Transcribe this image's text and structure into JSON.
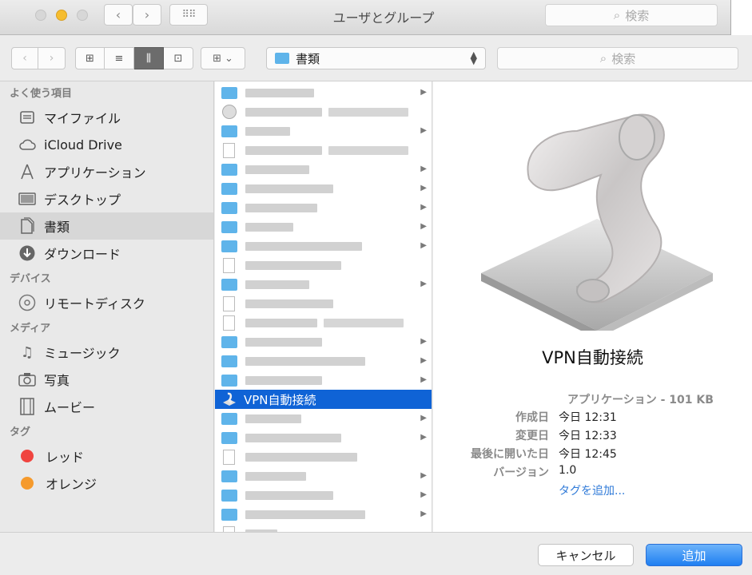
{
  "background_window": {
    "title": "ユーザとグループ",
    "search_placeholder": "検索",
    "back_icon": "‹",
    "forward_icon": "›",
    "grid_icon": "⠿⠿"
  },
  "toolbar": {
    "back_icon": "‹",
    "forward_icon": "›",
    "view_icons": [
      "⊞",
      "≡",
      "⫼",
      "⊡"
    ],
    "arrange_icon": "⊞",
    "arrange_chevron": "⌄",
    "location": "書類",
    "search_placeholder": "検索",
    "search_icon": "⌕"
  },
  "sidebar": {
    "favorites_title": "よく使う項目",
    "favorites": [
      {
        "label": "マイファイル",
        "icon": "all-files-icon"
      },
      {
        "label": "iCloud Drive",
        "icon": "cloud-icon"
      },
      {
        "label": "アプリケーション",
        "icon": "applications-icon"
      },
      {
        "label": "デスクトップ",
        "icon": "desktop-icon"
      },
      {
        "label": "書類",
        "icon": "documents-icon"
      },
      {
        "label": "ダウンロード",
        "icon": "downloads-icon"
      }
    ],
    "devices_title": "デバイス",
    "devices": [
      {
        "label": "リモートディスク",
        "icon": "disc-icon"
      }
    ],
    "media_title": "メディア",
    "media": [
      {
        "label": "ミュージック",
        "icon": "music-icon"
      },
      {
        "label": "写真",
        "icon": "camera-icon"
      },
      {
        "label": "ムービー",
        "icon": "film-icon"
      }
    ],
    "tags_title": "タグ",
    "tags": [
      {
        "label": "レッド",
        "color": "#f0443f"
      },
      {
        "label": "オレンジ",
        "color": "#f59a2c"
      }
    ]
  },
  "file_list": {
    "selected_name": "VPN自動接続"
  },
  "preview": {
    "name": "VPN自動接続",
    "kind": "アプリケーション - 101 KB",
    "rows": [
      {
        "label": "作成日",
        "value": "今日 12:31"
      },
      {
        "label": "変更日",
        "value": "今日 12:33"
      },
      {
        "label": "最後に開いた日",
        "value": "今日 12:45"
      },
      {
        "label": "バージョン",
        "value": "1.0"
      }
    ],
    "add_tag": "タグを追加..."
  },
  "buttons": {
    "cancel": "キャンセル",
    "add": "追加"
  },
  "colors": {
    "selection": "#0f63d6",
    "folder": "#5fb4ea",
    "primary_button": "#1f7ff1"
  }
}
